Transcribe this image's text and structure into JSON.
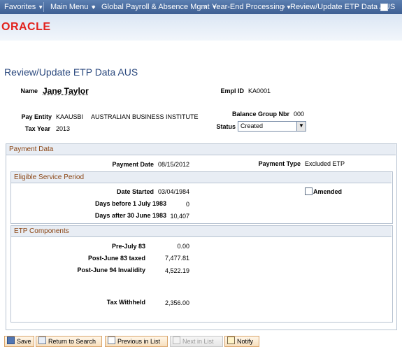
{
  "nav": {
    "favorites": "Favorites",
    "main_menu": "Main Menu",
    "crumb1": "Global Payroll & Absence Mgmt",
    "crumb2": "Year-End Processing",
    "crumb3": "Review/Update ETP Data AUS"
  },
  "brand": "ORACLE",
  "page_title": "Review/Update ETP Data AUS",
  "header": {
    "name_label": "Name",
    "name_value": "Jane Taylor",
    "emplid_label": "Empl ID",
    "emplid_value": "KA0001",
    "pay_entity_label": "Pay Entity",
    "pay_entity_code": "KAAUSBI",
    "pay_entity_desc": "AUSTRALIAN BUSINESS INSTITUTE",
    "balance_group_label": "Balance Group Nbr",
    "balance_group_value": "000",
    "tax_year_label": "Tax Year",
    "tax_year_value": "2013",
    "status_label": "Status",
    "status_value": "Created"
  },
  "payment": {
    "title": "Payment Data",
    "payment_date_label": "Payment Date",
    "payment_date_value": "08/15/2012",
    "payment_type_label": "Payment Type",
    "payment_type_value": "Excluded ETP"
  },
  "service": {
    "title": "Eligible Service Period",
    "date_started_label": "Date Started",
    "date_started_value": "03/04/1984",
    "amended_label": "Amended",
    "amended_checked": false,
    "days_before_label": "Days before 1 July 1983",
    "days_before_value": "0",
    "days_after_label": "Days after 30 June 1983",
    "days_after_value": "10,407"
  },
  "etp": {
    "title": "ETP Components",
    "pre_july_label": "Pre-July 83",
    "pre_july_value": "0.00",
    "post_june83_label": "Post-June 83 taxed",
    "post_june83_value": "7,477.81",
    "post_june94_label": "Post-June 94 Invalidity",
    "post_june94_value": "4,522.19",
    "tax_withheld_label": "Tax Withheld",
    "tax_withheld_value": "2,356.00"
  },
  "toolbar": {
    "save": "Save",
    "return": "Return to Search",
    "previous": "Previous in List",
    "next": "Next in List",
    "notify": "Notify"
  }
}
